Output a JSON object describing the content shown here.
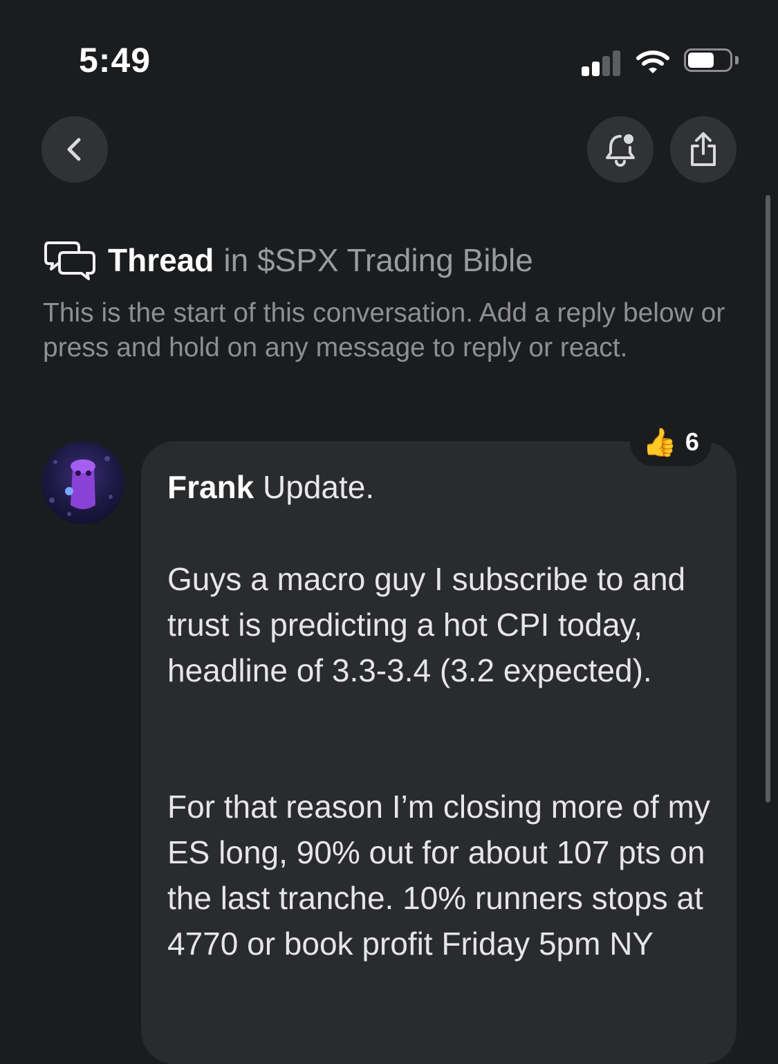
{
  "status_bar": {
    "time": "5:49",
    "signal_icon": "cellular-signal-icon",
    "wifi_icon": "wifi-icon",
    "battery_icon": "battery-icon"
  },
  "toolbar": {
    "back_icon": "chevron-left-icon",
    "notify_icon": "bell-icon",
    "share_icon": "share-icon"
  },
  "thread": {
    "icon": "chat-bubbles-icon",
    "title": "Thread",
    "channel": "in $SPX Trading Bible",
    "intro": "This is the start of this conversation. Add a reply below or press and hold on any message to reply or react."
  },
  "message": {
    "author": "Frank",
    "headline": "Update.",
    "paragraphs": [
      "Guys a macro guy I subscribe to and trust is predicting a hot CPI today, headline of 3.3-3.4 (3.2 expected).",
      "For that reason I’m closing more of my ES long, 90% out for about 107 pts on the last tranche. 10% runners stops at 4770 or book profit Friday 5pm NY"
    ],
    "reaction": {
      "emoji": "👍",
      "count": "6"
    }
  },
  "colors": {
    "background": "#1b1c1e",
    "bubble": "#2a2b2d",
    "button": "#313234",
    "muted_text": "#8e8f94"
  }
}
